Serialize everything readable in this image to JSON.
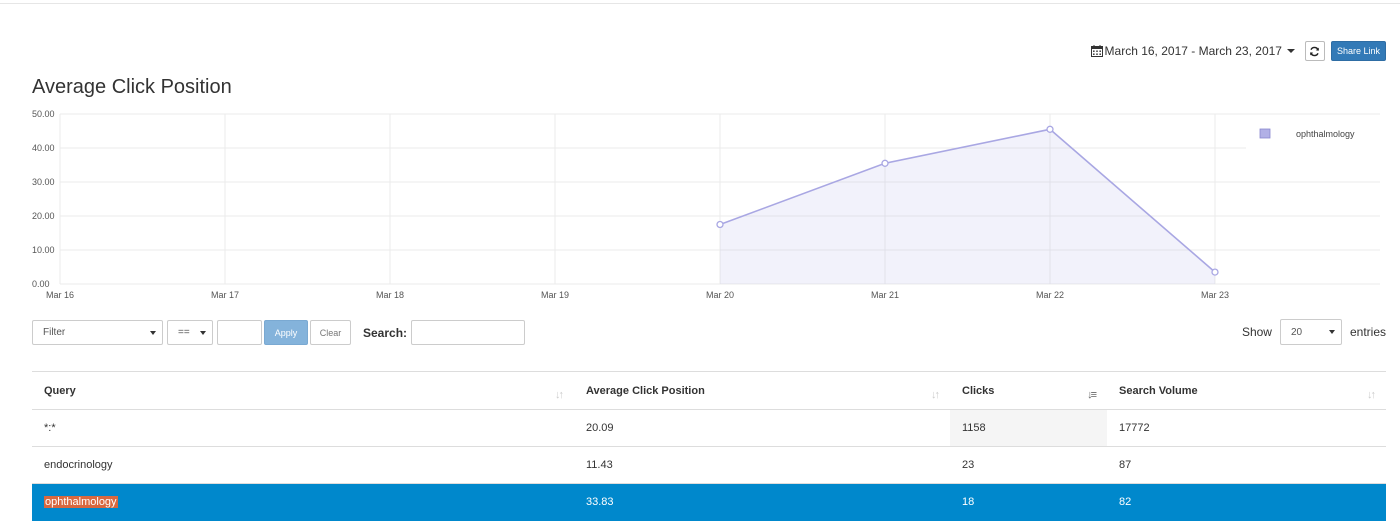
{
  "toolbar": {
    "date_range": "March 16, 2017 - March 23, 2017",
    "share_label": "Share Link",
    "calendar_icon": "calendar-icon",
    "refresh_icon": "refresh-icon"
  },
  "page_title": "Average Click Position",
  "chart_data": {
    "type": "area",
    "title": "Average Click Position",
    "categories": [
      "Mar 16",
      "Mar 17",
      "Mar 18",
      "Mar 19",
      "Mar 20",
      "Mar 21",
      "Mar 22",
      "Mar 23"
    ],
    "y_ticks": [
      "0.00",
      "10.00",
      "20.00",
      "30.00",
      "40.00",
      "50.00"
    ],
    "ylim": [
      0,
      50
    ],
    "series": [
      {
        "name": "ophthalmology",
        "color": "#a9a7e3",
        "values": [
          null,
          null,
          null,
          null,
          17.5,
          35.5,
          45.5,
          3.5
        ]
      }
    ],
    "grid": true,
    "legend_position": "top-right"
  },
  "filter": {
    "filter_placeholder": "Filter",
    "operator": "==",
    "apply_label": "Apply",
    "clear_label": "Clear",
    "search_label": "Search:"
  },
  "length": {
    "show_label": "Show",
    "value": "20",
    "entries_label": "entries"
  },
  "table": {
    "columns": [
      "Query",
      "Average Click Position",
      "Clicks",
      "Search Volume"
    ],
    "rows": [
      {
        "query": "*:*",
        "avg": "20.09",
        "clicks": "1158",
        "volume": "17772"
      },
      {
        "query": "endocrinology",
        "avg": "11.43",
        "clicks": "23",
        "volume": "87"
      },
      {
        "query": "ophthalmology",
        "avg": "33.83",
        "clicks": "18",
        "volume": "82"
      }
    ]
  }
}
